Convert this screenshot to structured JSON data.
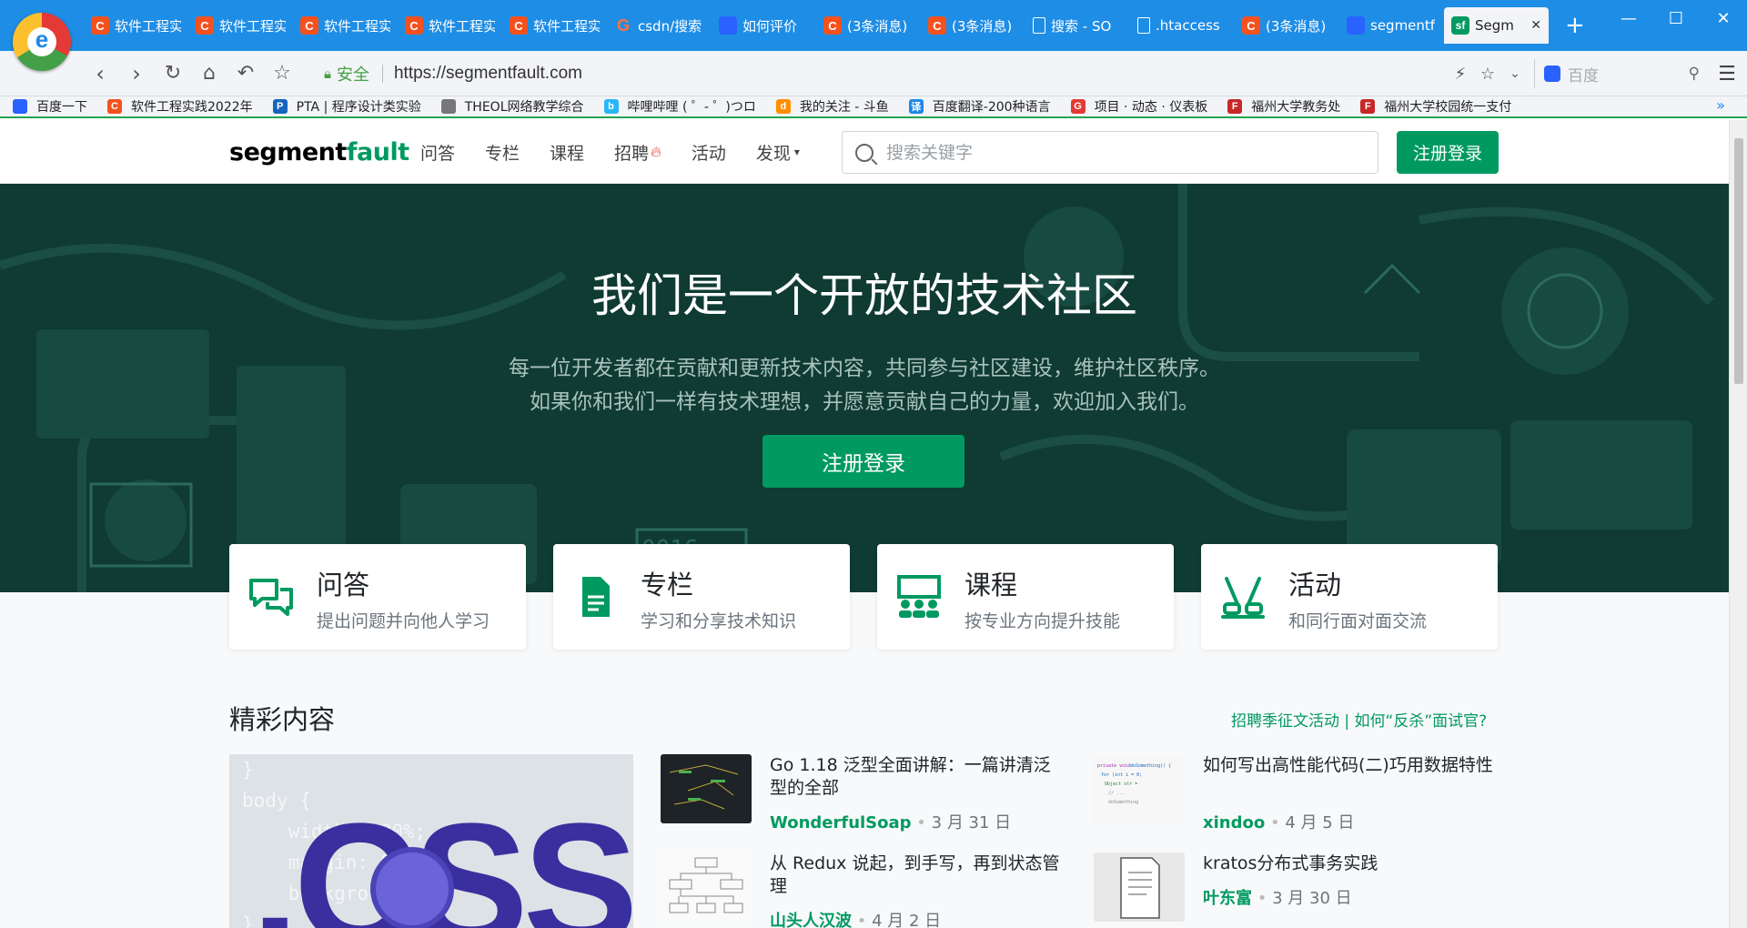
{
  "browser": {
    "tabs": [
      {
        "label": "软件工程实",
        "fav": "c"
      },
      {
        "label": "软件工程实",
        "fav": "c"
      },
      {
        "label": "软件工程实",
        "fav": "c"
      },
      {
        "label": "软件工程实",
        "fav": "c"
      },
      {
        "label": "软件工程实",
        "fav": "c"
      },
      {
        "label": "csdn/搜索",
        "fav": "g"
      },
      {
        "label": "如何评价",
        "fav": "paw"
      },
      {
        "label": "(3条消息)",
        "fav": "c"
      },
      {
        "label": "(3条消息)",
        "fav": "c"
      },
      {
        "label": "搜索 - SO",
        "fav": "doc"
      },
      {
        "label": ".htaccess",
        "fav": "doc"
      },
      {
        "label": "(3条消息)",
        "fav": "c"
      },
      {
        "label": "segmentf",
        "fav": "paw"
      }
    ],
    "active_tab": {
      "label": "Segm",
      "fav_text": "sf",
      "close": "✕"
    },
    "new_tab": "+",
    "secure_label": "安全",
    "url": "https://segmentfault.com",
    "search_placeholder": "百度",
    "bookmarks": [
      {
        "label": "百度一下",
        "icon": "paw",
        "color": "#2962ff"
      },
      {
        "label": "软件工程实践2022年",
        "icon": "C",
        "color": "#f4511e"
      },
      {
        "label": "PTA | 程序设计类实验",
        "icon": "P",
        "color": "#1565c0"
      },
      {
        "label": "THEOL网络教学综合",
        "icon": "doc",
        "color": "#777777"
      },
      {
        "label": "哔哩哔哩 ( ゜- ゜)つロ",
        "icon": "b",
        "color": "#29b6f6"
      },
      {
        "label": "我的关注 - 斗鱼",
        "icon": "d",
        "color": "#ff8f00"
      },
      {
        "label": "百度翻译-200种语言",
        "icon": "译",
        "color": "#1e88e5"
      },
      {
        "label": "项目 · 动态 · 仪表板",
        "icon": "G",
        "color": "#e53935"
      },
      {
        "label": "福州大学教务处",
        "icon": "F",
        "color": "#c62828"
      },
      {
        "label": "福州大学校园统一支付",
        "icon": "F",
        "color": "#c62828"
      }
    ],
    "bookmarks_more": "»"
  },
  "site": {
    "logo_a": "segment",
    "logo_b": "fault",
    "nav": [
      "问答",
      "专栏",
      "课程",
      "招聘",
      "活动",
      "发现"
    ],
    "search_placeholder": "搜索关键字",
    "register_button": "注册登录"
  },
  "hero": {
    "title": "我们是一个开放的技术社区",
    "line1": "每一位开发者都在贡献和更新技术内容，共同参与社区建设，维护社区秩序。",
    "line2": "如果你和我们一样有技术理想，并愿意贡献自己的力量，欢迎加入我们。",
    "button": "注册登录"
  },
  "cards": [
    {
      "title": "问答",
      "subtitle": "提出问题并向他人学习",
      "icon": "chat-bubbles-icon"
    },
    {
      "title": "专栏",
      "subtitle": "学习和分享技术知识",
      "icon": "document-icon"
    },
    {
      "title": "课程",
      "subtitle": "按专业方向提升技能",
      "icon": "classroom-icon"
    },
    {
      "title": "活动",
      "subtitle": "和同行面对面交流",
      "icon": "cheers-icon"
    }
  ],
  "featured": {
    "title": "精彩内容",
    "promo": "招聘季征文活动 | 如何“反杀”面试官?",
    "code_lines": [
      "}",
      "body {",
      "    width: 100%;",
      "    margin: 0;",
      "    background",
      "}"
    ],
    "css_text": ".CSS"
  },
  "articles": [
    {
      "title": "Go 1.18 泛型全面讲解：一篇讲清泛型的全部",
      "author": "WonderfulSoap",
      "date": "3 月 31 日"
    },
    {
      "title": "如何写出高性能代码(二)巧用数据特性",
      "author": "xindoo",
      "date": "4 月 5 日"
    },
    {
      "title": "从 Redux 说起，到手写，再到状态管理",
      "author": "山头人汉波",
      "date": "4 月 2 日"
    },
    {
      "title": "kratos分布式事务实践",
      "author": "叶东富",
      "date": "3 月 30 日"
    }
  ],
  "meta_dot": "•",
  "colors": {
    "brand": "#009a61",
    "hero_bg": "#0f3b33",
    "tabbar": "#1e8de6"
  }
}
